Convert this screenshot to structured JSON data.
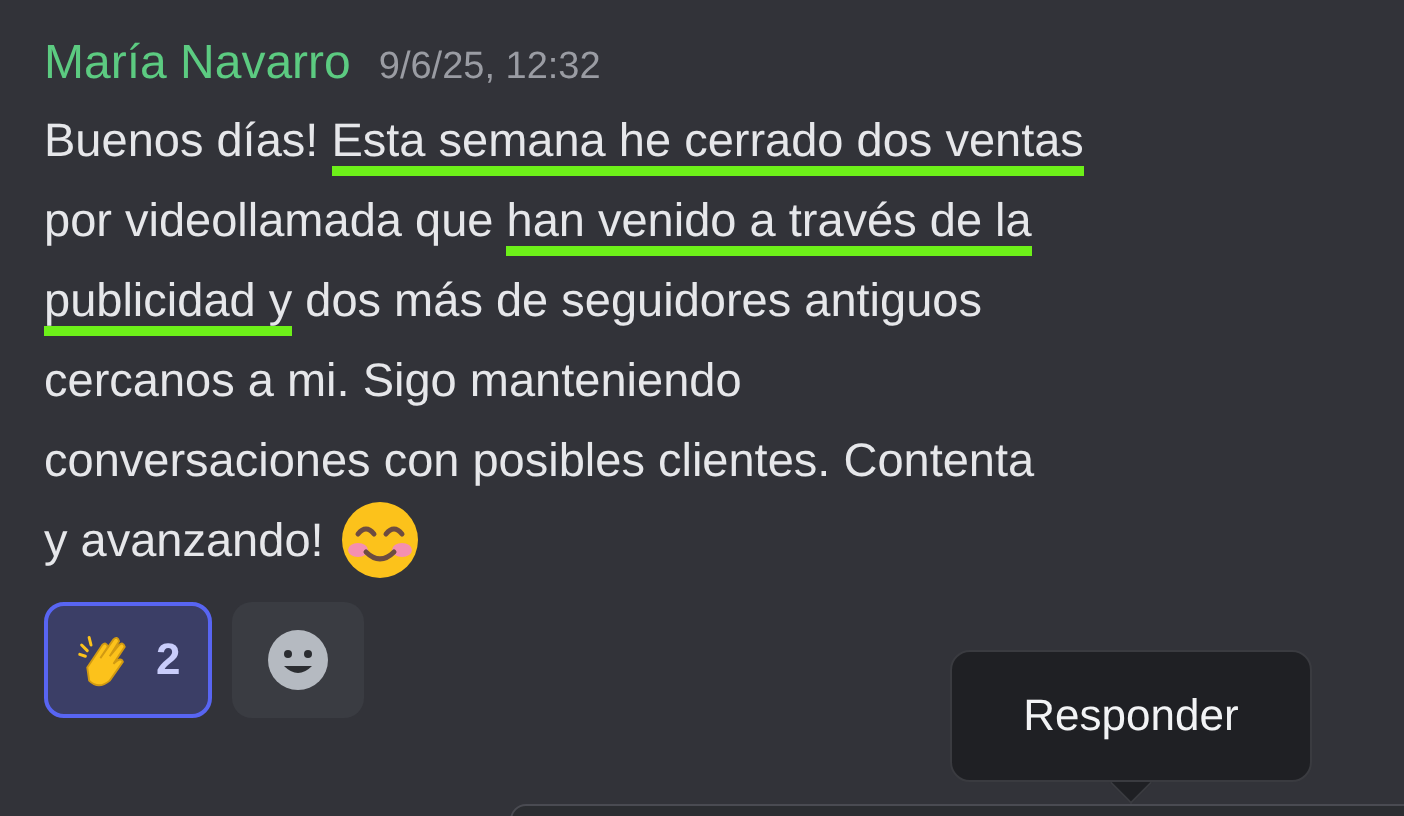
{
  "message": {
    "author": "María Navarro",
    "timestamp": "9/6/25, 12:32",
    "lines": [
      [
        {
          "text": "Buenos días! ",
          "highlighted": false
        },
        {
          "text": "Esta semana he cerrado dos ventas",
          "highlighted": true
        }
      ],
      [
        {
          "text": "por videollamada que ",
          "highlighted": false
        },
        {
          "text": "han venido a través de la",
          "highlighted": true
        }
      ],
      [
        {
          "text": "publicidad y",
          "highlighted": true
        },
        {
          "text": " dos más de seguidores antiguos",
          "highlighted": false
        }
      ],
      [
        {
          "text": "cercanos a mi. Sigo manteniendo",
          "highlighted": false
        }
      ],
      [
        {
          "text": "conversaciones con posibles clientes. Contenta",
          "highlighted": false
        }
      ],
      [
        {
          "text": "y avanzando!",
          "highlighted": false
        }
      ]
    ]
  },
  "reactions": [
    {
      "count": "2",
      "selected": true
    }
  ],
  "tooltip": {
    "label": "Responder"
  }
}
